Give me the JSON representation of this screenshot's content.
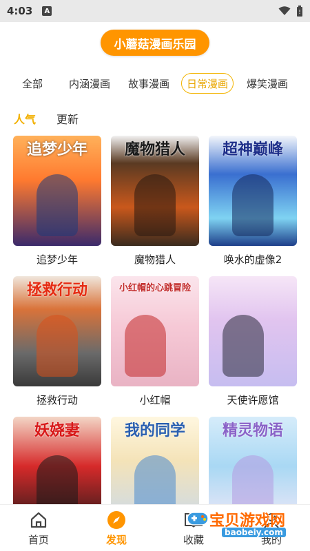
{
  "status_bar": {
    "time": "4:03",
    "badge": "A"
  },
  "header": {
    "title": "小蘑菇漫画乐园"
  },
  "category_tabs": [
    {
      "label": "全部",
      "active": false
    },
    {
      "label": "内涵漫画",
      "active": false
    },
    {
      "label": "故事漫画",
      "active": false
    },
    {
      "label": "日常漫画",
      "active": true
    },
    {
      "label": "爆笑漫画",
      "active": false
    }
  ],
  "sort_tabs": [
    {
      "label": "人气",
      "active": true
    },
    {
      "label": "更新",
      "active": false
    }
  ],
  "comics": [
    {
      "label": "追梦少年",
      "cover_text": "追梦少年",
      "colors": [
        "#ff8a3d",
        "#3b2a6b"
      ]
    },
    {
      "label": "魔物猎人",
      "cover_text": "魔物猎人",
      "colors": [
        "#3a2b1e",
        "#c9581c"
      ]
    },
    {
      "label": "唤水的虚像2",
      "cover_text": "超神巅峰",
      "colors": [
        "#1e3f8a",
        "#7fd3f2"
      ]
    },
    {
      "label": "拯救行动",
      "cover_text": "拯救行动",
      "colors": [
        "#b24b1a",
        "#3a3a3a"
      ]
    },
    {
      "label": "小红帽",
      "cover_text": "小红帽的心跳冒险",
      "colors": [
        "#f6c9d6",
        "#c22a2a"
      ]
    },
    {
      "label": "天使许愿馆",
      "cover_text": "",
      "colors": [
        "#e8c6ee",
        "#b9b6e8"
      ]
    },
    {
      "label": "",
      "cover_text": "妖娆妻",
      "colors": [
        "#b3121a",
        "#2a1a1a"
      ]
    },
    {
      "label": "",
      "cover_text": "我的同学",
      "colors": [
        "#f4e3b8",
        "#4a8ad0"
      ]
    },
    {
      "label": "",
      "cover_text": "精灵物语",
      "colors": [
        "#a9d8f4",
        "#f3e9f7"
      ]
    }
  ],
  "bottom_nav": [
    {
      "label": "首页",
      "icon": "home-icon",
      "active": false
    },
    {
      "label": "发现",
      "icon": "compass-icon",
      "active": true
    },
    {
      "label": "收藏",
      "icon": "book-icon",
      "active": false
    },
    {
      "label": "我的",
      "icon": "user-icon",
      "active": false
    }
  ],
  "watermark": {
    "text": "宝贝游戏网",
    "url": "baobeiy.com"
  },
  "accent_color": "#ff9500"
}
